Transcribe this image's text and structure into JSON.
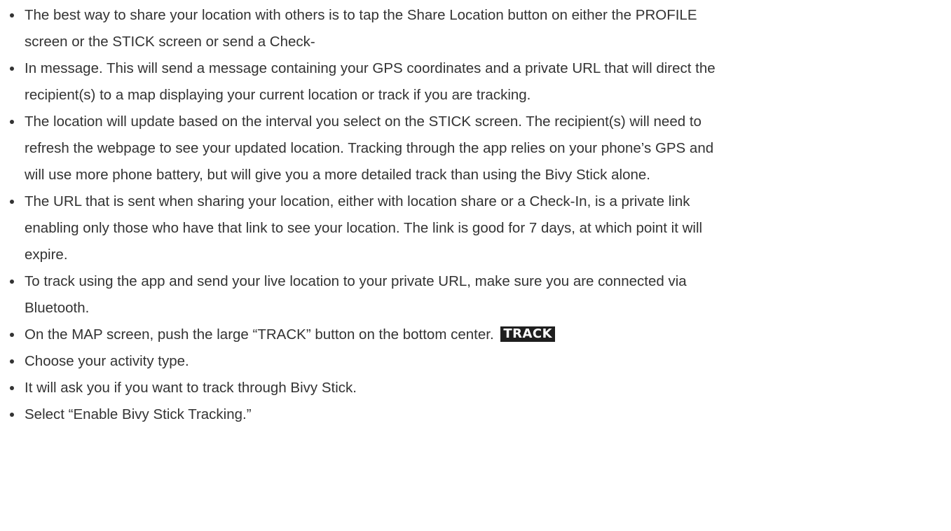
{
  "bullets": [
    {
      "lines": [
        "The best way to share your location with others is to tap the Share Location button on either the PROFILE",
        "screen or the STICK screen or send a Check-"
      ]
    },
    {
      "lines": [
        "In message. This will send a message containing your GPS coordinates and a private URL that will direct the",
        "recipient(s) to a map displaying your current location or track if you are tracking."
      ]
    },
    {
      "lines": [
        "The location will update based on the interval you select on the STICK screen. The recipient(s) will need to",
        "refresh the webpage to see your updated location. Tracking through the app relies on your phone’s GPS and",
        "will use more phone battery, but will give you a more detailed track than using the Bivy Stick alone."
      ]
    },
    {
      "lines": [
        "The URL that is sent when sharing your location, either with location share or a Check-In, is a private link",
        "enabling only those who have that link to see your location. The link is good for 7 days, at which point it will",
        "expire."
      ]
    },
    {
      "lines": [
        "To track using the app and send your live location to your private URL, make sure you are connected via",
        "Bluetooth."
      ]
    },
    {
      "lines": [
        "On the MAP screen, push the large “TRACK” button on the bottom center."
      ],
      "badge": "TRACK"
    },
    {
      "lines": [
        "Choose your activity type."
      ]
    },
    {
      "lines": [
        "It will ask you if you want to track through Bivy Stick."
      ]
    },
    {
      "lines": [
        "Select “Enable Bivy Stick Tracking.”"
      ]
    }
  ]
}
